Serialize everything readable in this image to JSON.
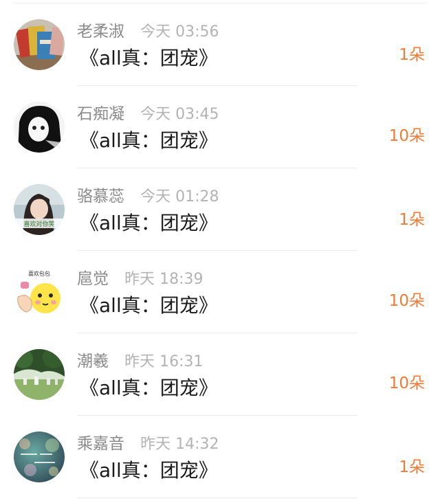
{
  "accent_color": "#f07a34",
  "items": [
    {
      "name": "老柔淑",
      "time": "今天 03:56",
      "title": "《all真：团宠》",
      "amount": "1朵",
      "avatar_icon": "notebooks-avatar"
    },
    {
      "name": "石痴凝",
      "time": "今天 03:45",
      "title": "《all真：团宠》",
      "amount": "10朵",
      "avatar_icon": "anime-girl-avatar"
    },
    {
      "name": "骆慕蕊",
      "time": "今天 01:28",
      "title": "《all真：团宠》",
      "amount": "1朵",
      "avatar_icon": "photo-girl-avatar",
      "avatar_caption": "喜欢对你笑"
    },
    {
      "name": "扈觉",
      "time": "昨天 18:39",
      "title": "《all真：团宠》",
      "amount": "10朵",
      "avatar_icon": "emoji-face-avatar",
      "avatar_caption": "喜欢包包"
    },
    {
      "name": "潮羲",
      "time": "昨天 16:31",
      "title": "《all真：团宠》",
      "amount": "10朵",
      "avatar_icon": "park-scene-avatar"
    },
    {
      "name": "乘嘉音",
      "time": "昨天 14:32",
      "title": "《all真：团宠》",
      "amount": "1朵",
      "avatar_icon": "bokeh-text-avatar"
    }
  ]
}
